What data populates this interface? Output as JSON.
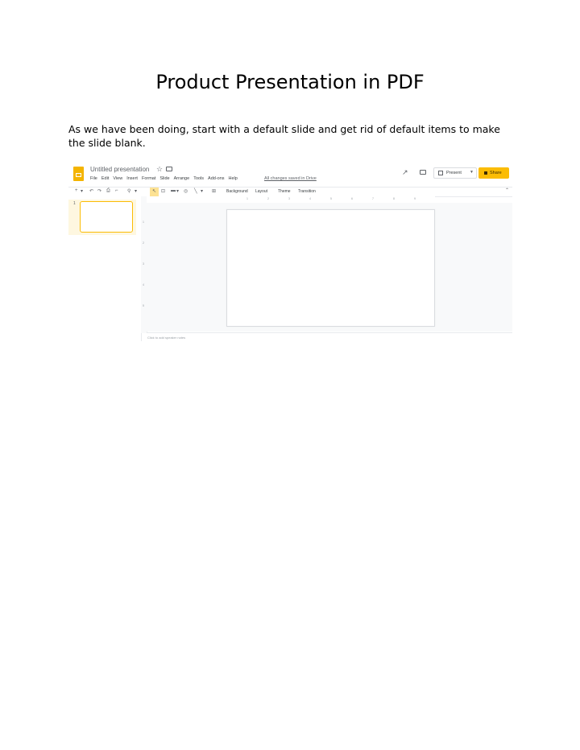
{
  "document": {
    "title": "Product Presentation in PDF",
    "paragraph": "As we have been doing, start with a default slide and get rid of default items to make the slide blank."
  },
  "slides_app": {
    "presentation_title": "Untitled presentation",
    "menu": [
      "File",
      "Edit",
      "View",
      "Insert",
      "Format",
      "Slide",
      "Arrange",
      "Tools",
      "Add-ons",
      "Help"
    ],
    "saved_status": "All changes saved in Drive",
    "present_label": "Present",
    "share_label": "Share",
    "toolbar": {
      "background_label": "Background",
      "layout_label": "Layout",
      "theme_label": "Theme",
      "transition_label": "Transition"
    },
    "slide_number": "1",
    "ruler_h": [
      "1",
      "2",
      "3",
      "4",
      "5",
      "6",
      "7",
      "8",
      "9"
    ],
    "ruler_v": [
      "1",
      "2",
      "3",
      "4",
      "5"
    ],
    "notes_label": "Click to add speaker notes",
    "colors": {
      "accent": "#fbbc04",
      "logo": "#f4b400"
    }
  }
}
